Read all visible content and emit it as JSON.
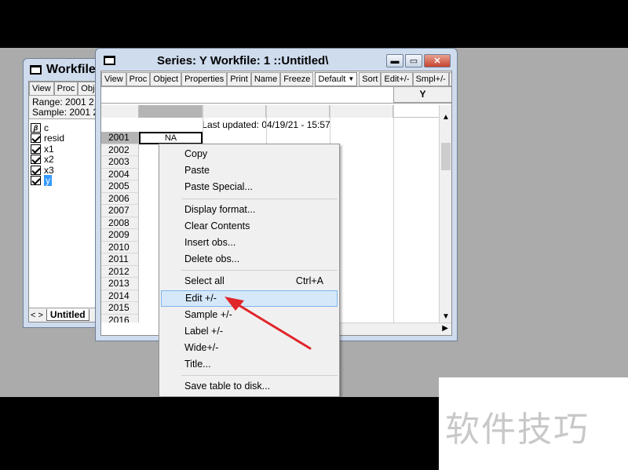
{
  "workfile_window": {
    "title": "Workfile:",
    "toolbar": [
      "View",
      "Proc",
      "Object"
    ],
    "range": "Range:  2001 2",
    "sample": "Sample: 2001 2",
    "items": [
      {
        "icon": "beta-icon",
        "label": "c"
      },
      {
        "icon": "series-icon",
        "label": "resid"
      },
      {
        "icon": "series-icon",
        "label": "x1"
      },
      {
        "icon": "series-icon",
        "label": "x2"
      },
      {
        "icon": "series-icon",
        "label": "x3"
      },
      {
        "icon": "series-icon",
        "label": "y"
      }
    ],
    "tab_nav": "< >",
    "tab": "Untitled"
  },
  "series_window": {
    "title": "Series: Y   Workfile: 1 ::Untitled\\",
    "caption_buttons": {
      "minimize": "▬",
      "maximize": "▭",
      "close": "✕"
    },
    "toolbar_left": [
      "View",
      "Proc",
      "Object",
      "Properties"
    ],
    "toolbar_mid": [
      "Print",
      "Name",
      "Freeze"
    ],
    "format_select": "Default",
    "toolbar_right": [
      "Sort",
      "Edit+/-",
      "Smpl+/-",
      "La"
    ],
    "column_header": "Y",
    "last_updated": "Last updated: 04/19/21 - 15:57",
    "active_cell": "NA",
    "years": [
      "2001",
      "2002",
      "2003",
      "2004",
      "2005",
      "2006",
      "2007",
      "2008",
      "2009",
      "2010",
      "2011",
      "2012",
      "2013",
      "2014",
      "2015",
      "2016"
    ]
  },
  "context_menu": {
    "groups": [
      [
        {
          "label": "Copy"
        },
        {
          "label": "Paste"
        },
        {
          "label": "Paste Special..."
        }
      ],
      [
        {
          "label": "Display format..."
        },
        {
          "label": "Clear Contents"
        },
        {
          "label": "Insert obs..."
        },
        {
          "label": "Delete obs..."
        }
      ],
      [
        {
          "label": "Select all",
          "shortcut": "Ctrl+A"
        },
        {
          "label": "Edit +/-",
          "highlighted": true
        },
        {
          "label": "Sample +/-"
        },
        {
          "label": "Label +/-"
        },
        {
          "label": "Wide+/-"
        },
        {
          "label": "Title..."
        }
      ],
      [
        {
          "label": "Save table to disk..."
        }
      ]
    ]
  },
  "watermark": "软件技巧",
  "colors": {
    "arrow": "#e0262b",
    "highlight": "#d5e8fa",
    "titlebar": "#cfdcee"
  }
}
